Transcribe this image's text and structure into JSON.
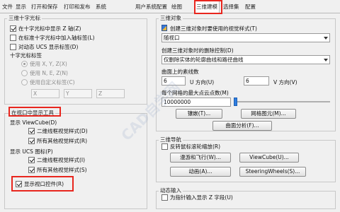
{
  "tabs": [
    {
      "label": "文件"
    },
    {
      "label": "显示"
    },
    {
      "label": "打开和保存"
    },
    {
      "label": "打印和发布"
    },
    {
      "label": "系统"
    },
    {
      "label": "用户系统配置"
    },
    {
      "label": "绘图"
    },
    {
      "label": "三维建模"
    },
    {
      "label": "选择集"
    },
    {
      "label": "配置"
    }
  ],
  "cursor3d": {
    "title": "三维十字光标",
    "show_z_axis": "在十字光标中显示 Z 轴(Z)",
    "label_axes": "在标准十字光标中加入轴标签(L)",
    "dynamic_ucs_label": "对动态 UCS 显示标签(D)",
    "crosshair_labels_title": "十字光标标签",
    "radio_xyz": "使用 X, Y, Z(X)",
    "radio_nez": "使用 N, E, Z(N)",
    "radio_custom": "使用自定义标签(C)",
    "custom_x": "X",
    "custom_y": "Y",
    "custom_z": "Z"
  },
  "viewport_tools": {
    "title": "在视口中显示工具",
    "viewcube_label": "显示 ViewCube(D)",
    "viewcube_2d": "二维线框视觉样式(D)",
    "viewcube_other": "所有其他视觉样式(R)",
    "ucs_label": "显示 UCS 图标(P)",
    "ucs_2d": "二维线框视觉样式(I)",
    "ucs_other": "所有其他视觉样式(S)",
    "show_viewport_controls": "显示视口控件(R)"
  },
  "objects3d": {
    "title": "三维对象",
    "visual_style_label": "创建三维对象时要使用的视觉样式(T)",
    "visual_style_value": "随视口",
    "deletion_label": "创建三维对象时的删除控制(D)",
    "deletion_value": "仅删除实体的轮廓曲线和路径曲线",
    "isolines_label": "曲面上的素线数",
    "u_value": "6",
    "u_label": "U 方向(U)",
    "v_value": "6",
    "v_label": "V 方向(V)",
    "vertices_label": "每个网格的最大点云点数(M)",
    "vertices_value": "10000000",
    "tessellation_button": "镶嵌(T)...",
    "mesh_primitives_button": "网格图元(M)...",
    "surface_analysis_button": "曲面分析(F)..."
  },
  "navigation3d": {
    "title": "三维导航",
    "reverse_wheel": "反转鼠标滚轮缩放(R)",
    "walk_fly_button": "漫游和飞行(W)...",
    "viewcube_button": "ViewCube(U)...",
    "animation_button": "动画(A)...",
    "steeringwheels_button": "SteeringWheels(S)..."
  },
  "dynamic_input": {
    "title": "动态输入",
    "z_field": "为指针输入显示 Z 字段(U)"
  },
  "watermark": "CAD自学网",
  "colors": {
    "highlight": "#e8261e",
    "slider": "#2f7de0"
  }
}
